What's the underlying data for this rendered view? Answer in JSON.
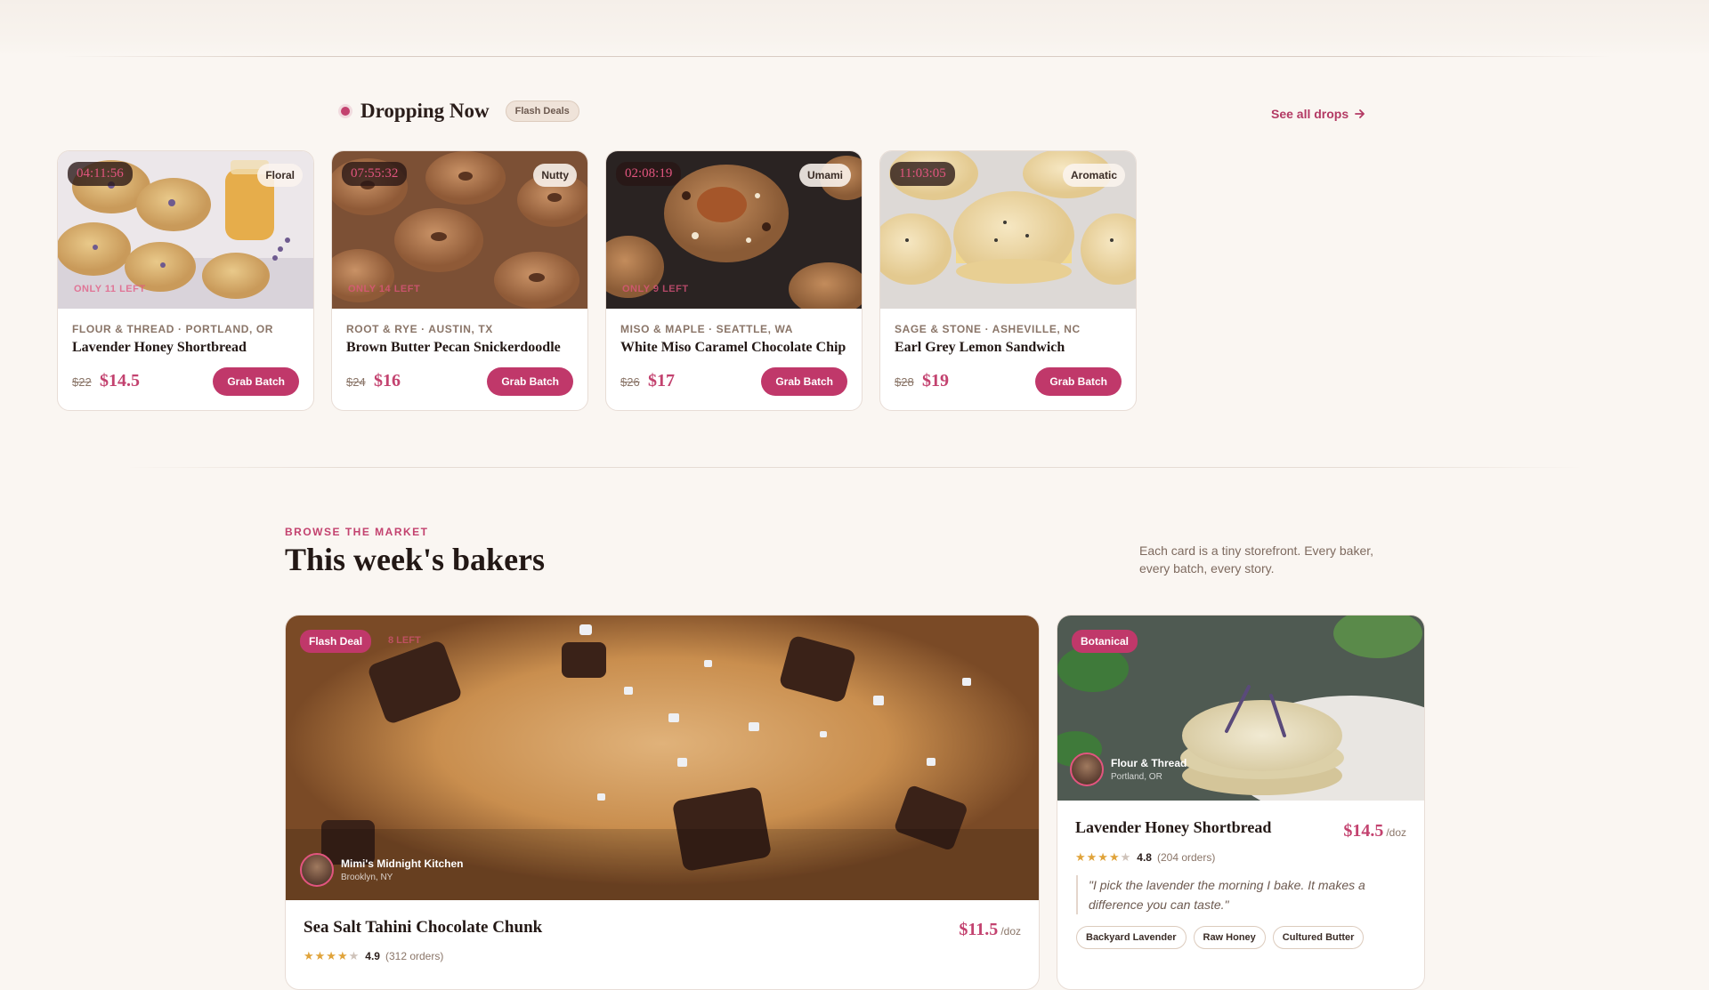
{
  "drops": {
    "title": "Dropping Now",
    "badge": "Flash Deals",
    "see_all": "See all drops",
    "cards": [
      {
        "timer": "04:11:56",
        "flavor": "Floral",
        "left": "ONLY 11 LEFT",
        "meta": "FLOUR & THREAD · PORTLAND, OR",
        "name": "Lavender Honey Shortbread",
        "old_price": "$22",
        "price": "$14.5",
        "button": "Grab Batch"
      },
      {
        "timer": "07:55:32",
        "flavor": "Nutty",
        "left": "ONLY 14 LEFT",
        "meta": "ROOT & RYE · AUSTIN, TX",
        "name": "Brown Butter Pecan Snickerdoodle",
        "old_price": "$24",
        "price": "$16",
        "button": "Grab Batch"
      },
      {
        "timer": "02:08:19",
        "flavor": "Umami",
        "left": "ONLY 9 LEFT",
        "meta": "MISO & MAPLE · SEATTLE, WA",
        "name": "White Miso Caramel Chocolate Chip",
        "old_price": "$26",
        "price": "$17",
        "button": "Grab Batch"
      },
      {
        "timer": "11:03:05",
        "flavor": "Aromatic",
        "left": "",
        "meta": "SAGE & STONE · ASHEVILLE, NC",
        "name": "Earl Grey Lemon Sandwich",
        "old_price": "$28",
        "price": "$19",
        "button": "Grab Batch"
      }
    ]
  },
  "browse": {
    "eyebrow": "BROWSE THE MARKET",
    "title": "This week's bakers",
    "description": "Each card is a tiny storefront. Every baker, every batch, every story.",
    "featured": {
      "tag": "Flash Deal",
      "ghost_tag": "8 LEFT",
      "baker_name": "Mimi's Midnight Kitchen",
      "baker_location": "Brooklyn, NY",
      "name": "Sea Salt Tahini Chocolate Chunk",
      "price": "$11.5",
      "unit": "/doz",
      "rating": "4.9",
      "orders": "(312 orders)"
    },
    "side": {
      "tag": "Botanical",
      "baker_name": "Flour & Thread",
      "baker_location": "Portland, OR",
      "name": "Lavender Honey Shortbread",
      "price": "$14.5",
      "unit": "/doz",
      "rating": "4.8",
      "orders": "(204 orders)",
      "quote": "\"I pick the lavender the morning I bake. It makes a difference you can taste.\"",
      "chips": [
        "Backyard Lavender",
        "Raw Honey",
        "Cultured Butter"
      ]
    }
  },
  "colors": {
    "accent": "#c0386a",
    "background": "#faf6f2",
    "timer_text": "#e2557f",
    "star": "#e0a33a"
  }
}
